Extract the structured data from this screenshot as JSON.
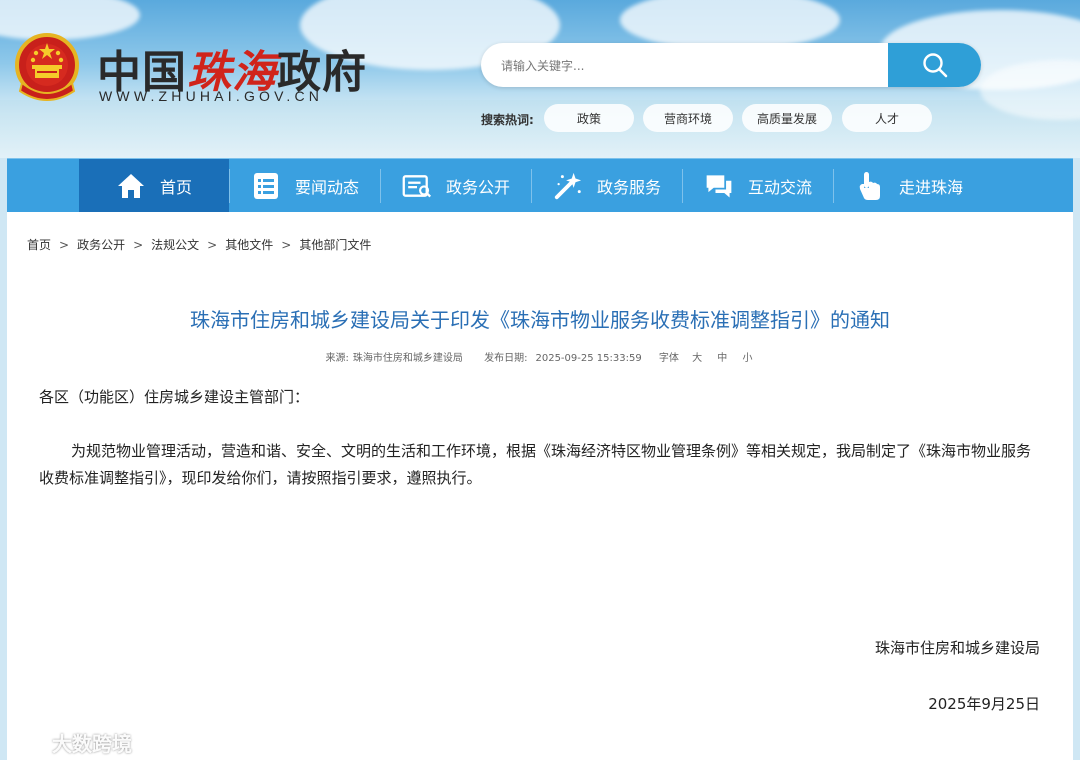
{
  "header": {
    "logo_cn_part1": "中国",
    "logo_cn_part2": "珠海",
    "logo_cn_part3": "政府",
    "logo_en": "WWW.ZHUHAI.GOV.CN",
    "emblem_icon": "national-emblem-icon"
  },
  "search": {
    "placeholder": "请输入关键字...",
    "button_icon": "search-icon",
    "hot_label": "搜索热词:",
    "hot_tags": [
      "政策",
      "营商环境",
      "高质量发展",
      "人才"
    ]
  },
  "nav": {
    "items": [
      {
        "label": "首页",
        "icon": "home-icon"
      },
      {
        "label": "要闻动态",
        "icon": "news-list-icon"
      },
      {
        "label": "政务公开",
        "icon": "document-icon"
      },
      {
        "label": "政务服务",
        "icon": "magic-wand-icon"
      },
      {
        "label": "互动交流",
        "icon": "chat-icon"
      },
      {
        "label": "走进珠海",
        "icon": "hand-pointer-icon"
      }
    ]
  },
  "breadcrumb": [
    "首页",
    "政务公开",
    "法规公文",
    "其他文件",
    "其他部门文件"
  ],
  "article": {
    "title": "珠海市住房和城乡建设局关于印发《珠海市物业服务收费标准调整指引》的通知",
    "source_label": "来源:",
    "source": "珠海市住房和城乡建设局",
    "date_label": "发布日期:",
    "date": "2025-09-25 15:33:59",
    "fontsize_label": "字体",
    "fontsize_large": "大",
    "fontsize_medium": "中",
    "fontsize_small": "小",
    "salutation": "各区（功能区）住房城乡建设主管部门：",
    "body": "为规范物业管理活动，营造和谐、安全、文明的生活和工作环境，根据《珠海经济特区物业管理条例》等相关规定，我局制定了《珠海市物业服务收费标准调整指引》，现印发给你们，请按照指引要求，遵照执行。",
    "signature": "珠海市住房和城乡建设局",
    "sign_date": "2025年9月25日"
  },
  "watermark": {
    "text": "大数跨境",
    "icon": "watermark-logo-icon"
  },
  "colors": {
    "nav_bg": "#3aa0e0",
    "nav_active": "#1a6fb8",
    "title": "#2a6fb5",
    "logo_red": "#d0241b",
    "search_button": "#2f9fd7"
  }
}
